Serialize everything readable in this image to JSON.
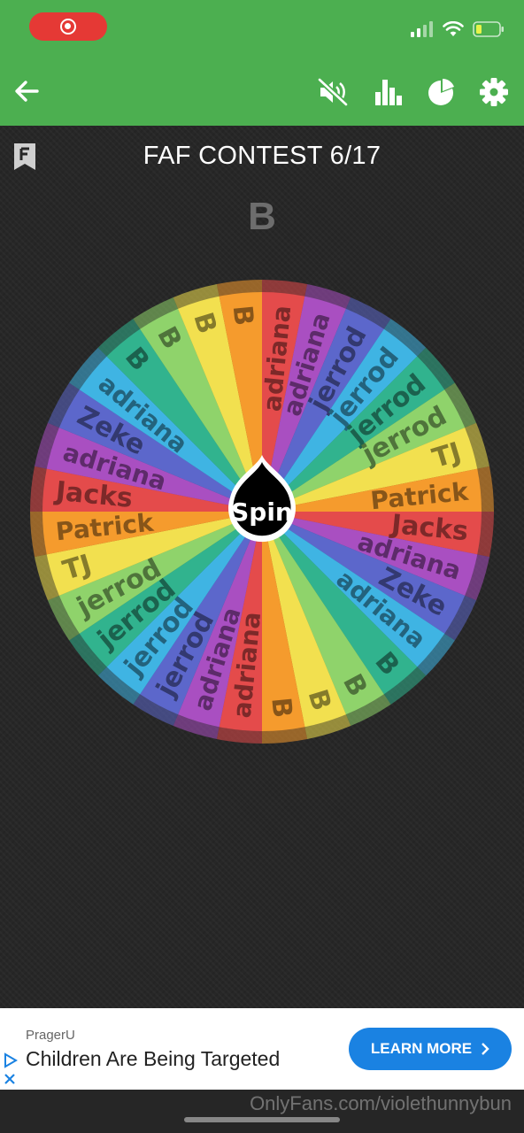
{
  "app": {
    "title": "FAF CONTEST 6/17",
    "result": "B",
    "spin_label": "Spin"
  },
  "colors": {
    "appbar": "#4caf50",
    "background": "#262626",
    "recording_pill": "#e53935",
    "ad_button": "#1a82e2"
  },
  "icons": {
    "recording": "recording-icon",
    "signal": "signal-icon",
    "wifi": "wifi-icon",
    "battery": "battery-low-icon",
    "back": "back-arrow-icon",
    "mute": "mute-icon",
    "stats": "bar-chart-icon",
    "pie": "pie-chart-icon",
    "settings": "gear-icon",
    "bookmark": "bookmark-icon"
  },
  "wheel": {
    "segments": [
      {
        "label": "adriana",
        "color": "#e44b4b"
      },
      {
        "label": "adriana",
        "color": "#a94fc1"
      },
      {
        "label": "jerrod",
        "color": "#5c67cb"
      },
      {
        "label": "jerrod",
        "color": "#3fb4e3"
      },
      {
        "label": "jerrod",
        "color": "#31b38e"
      },
      {
        "label": "jerrod",
        "color": "#8fd36b"
      },
      {
        "label": "TJ",
        "color": "#f2e04f"
      },
      {
        "label": "Patrick",
        "color": "#f59b2d"
      },
      {
        "label": "Jacks",
        "color": "#e44b4b"
      },
      {
        "label": "adriana",
        "color": "#a94fc1"
      },
      {
        "label": "Zeke",
        "color": "#5c67cb"
      },
      {
        "label": "adriana",
        "color": "#3fb4e3"
      },
      {
        "label": "B",
        "color": "#31b38e"
      },
      {
        "label": "B",
        "color": "#8fd36b"
      },
      {
        "label": "B",
        "color": "#f2e04f"
      },
      {
        "label": "B",
        "color": "#f59b2d"
      },
      {
        "label": "adriana",
        "color": "#e44b4b"
      },
      {
        "label": "adriana",
        "color": "#a94fc1"
      },
      {
        "label": "jerrod",
        "color": "#5c67cb"
      },
      {
        "label": "jerrod",
        "color": "#3fb4e3"
      },
      {
        "label": "jerrod",
        "color": "#31b38e"
      },
      {
        "label": "jerrod",
        "color": "#8fd36b"
      },
      {
        "label": "TJ",
        "color": "#f2e04f"
      },
      {
        "label": "Patrick",
        "color": "#f59b2d"
      },
      {
        "label": "Jacks",
        "color": "#e44b4b"
      },
      {
        "label": "adriana",
        "color": "#a94fc1"
      },
      {
        "label": "Zeke",
        "color": "#5c67cb"
      },
      {
        "label": "adriana",
        "color": "#3fb4e3"
      },
      {
        "label": "B",
        "color": "#31b38e"
      },
      {
        "label": "B",
        "color": "#8fd36b"
      },
      {
        "label": "B",
        "color": "#f2e04f"
      },
      {
        "label": "B",
        "color": "#f59b2d"
      }
    ]
  },
  "ad": {
    "advertiser": "PragerU",
    "headline": "Children Are Being Targeted",
    "cta": "LEARN MORE"
  },
  "watermark": "OnlyFans.com/violethunnybun"
}
